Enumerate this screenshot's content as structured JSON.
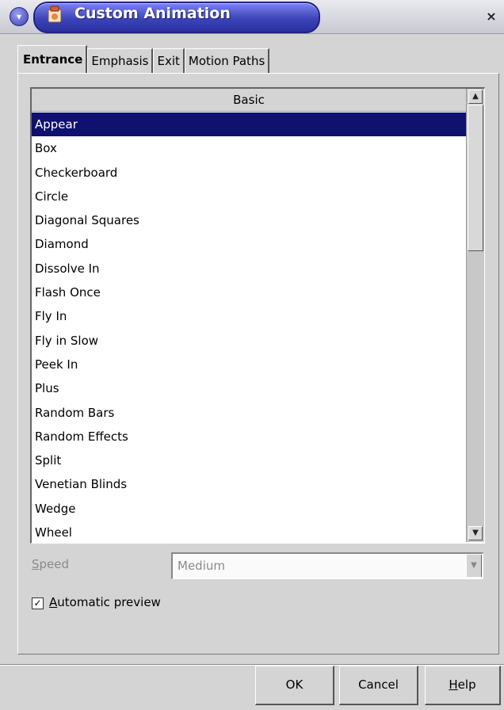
{
  "window": {
    "title": "Custom Animation",
    "close_glyph": "×",
    "menu_glyph": "▾"
  },
  "tabs": [
    {
      "label": "Entrance",
      "active": true
    },
    {
      "label": "Emphasis",
      "active": false
    },
    {
      "label": "Exit",
      "active": false
    },
    {
      "label": "Motion Paths",
      "active": false
    }
  ],
  "effects_list": {
    "header": "Basic",
    "selected_index": 0,
    "items": [
      "Appear",
      "Box",
      "Checkerboard",
      "Circle",
      "Diagonal Squares",
      "Diamond",
      "Dissolve In",
      "Flash Once",
      "Fly In",
      "Fly in Slow",
      "Peek In",
      "Plus",
      "Random Bars",
      "Random Effects",
      "Split",
      "Venetian Blinds",
      "Wedge",
      "Wheel"
    ]
  },
  "speed": {
    "label_first": "S",
    "label_rest": "peed",
    "value": "Medium",
    "enabled": false
  },
  "auto_preview": {
    "label_first": "A",
    "label_rest": "utomatic preview",
    "checked": true
  },
  "buttons": {
    "ok": "OK",
    "cancel": "Cancel",
    "help_first": "H",
    "help_rest": "elp"
  },
  "colors": {
    "selection": "#10106e",
    "title_bar": "#3c44b8",
    "dialog_bg": "#d4d4d4"
  },
  "icons": {
    "window_menu": "chevron-down-icon",
    "title": "presentation-app-icon",
    "close": "close-icon",
    "scroll_up": "arrow-up-icon",
    "scroll_down": "arrow-down-icon",
    "dropdown": "arrow-down-icon",
    "check": "checkmark-icon"
  }
}
